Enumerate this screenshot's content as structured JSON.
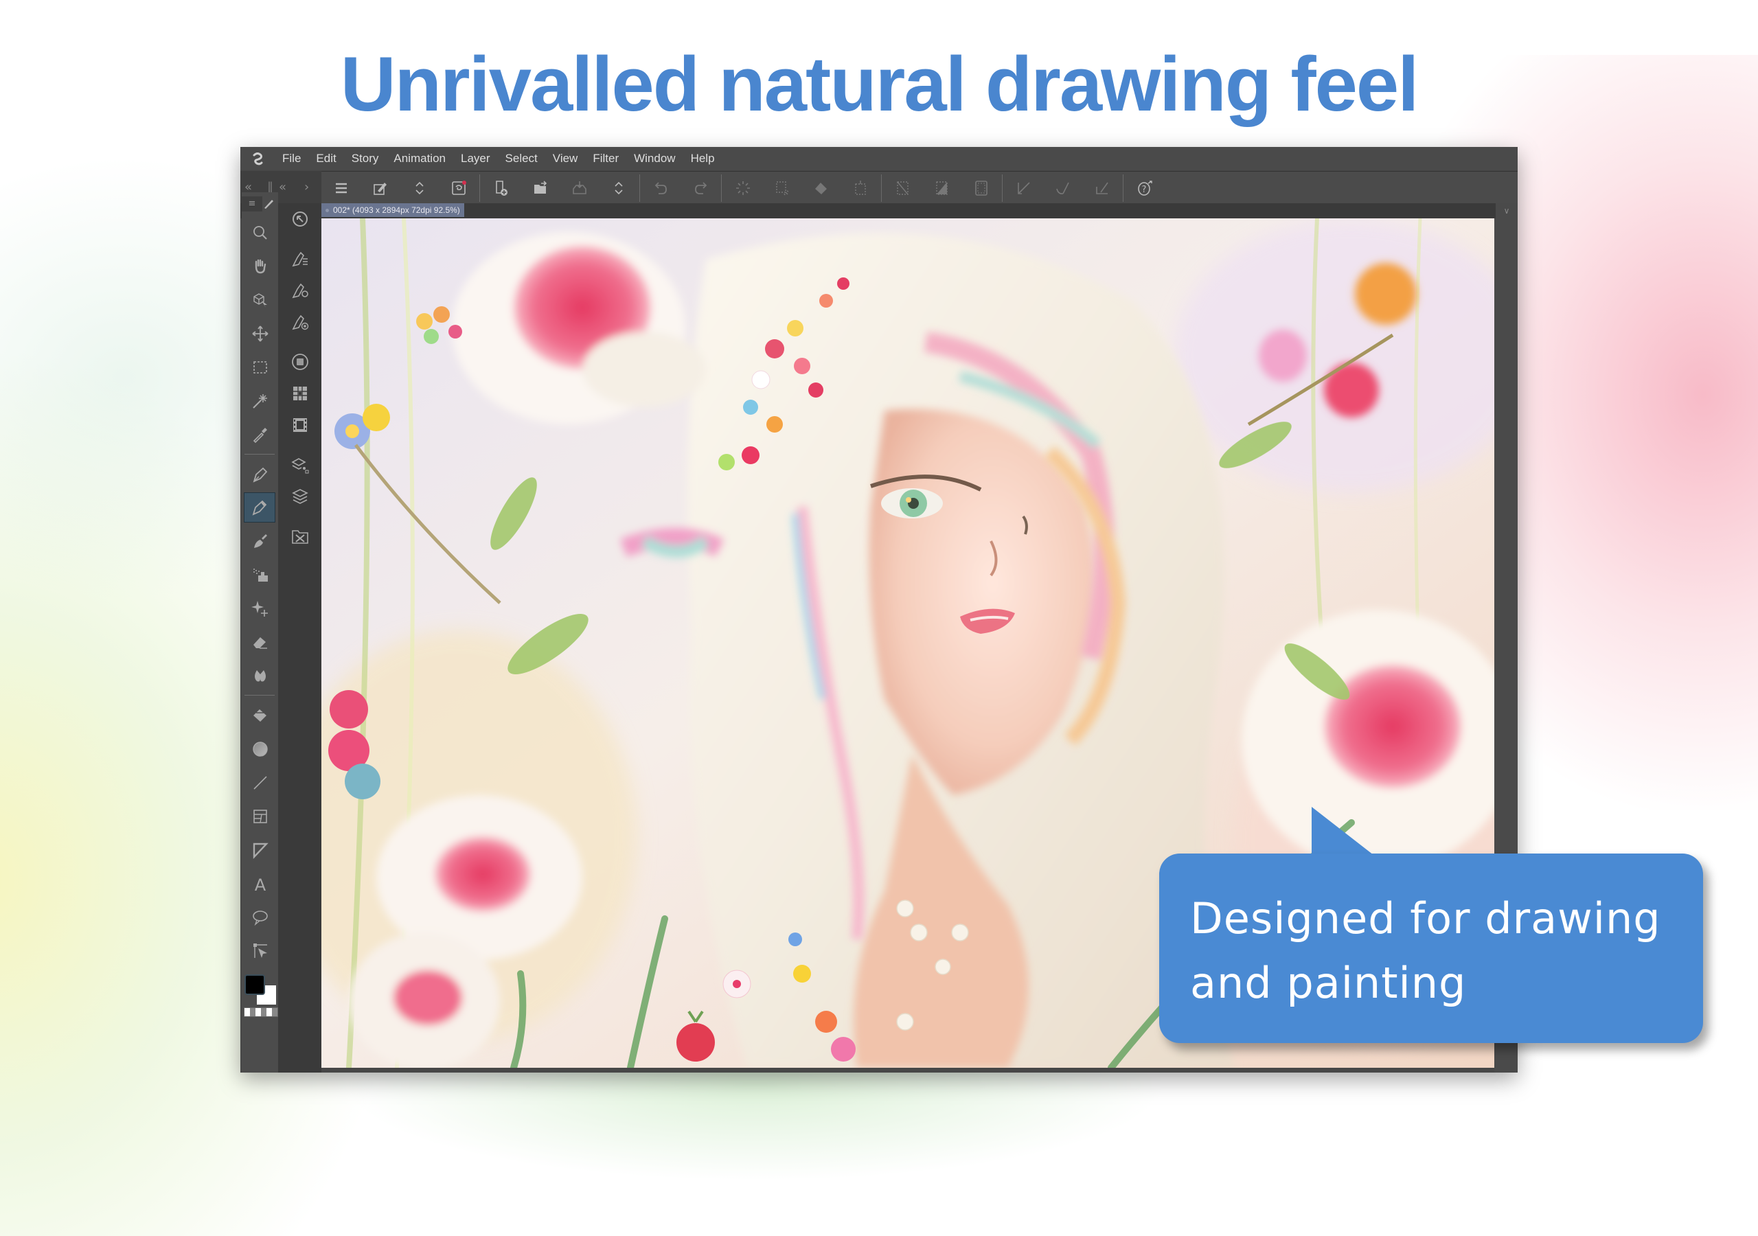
{
  "headline": "Unrivalled natural drawing feel",
  "callout": {
    "line1": "Designed for drawing",
    "line2": "and painting"
  },
  "colors": {
    "accent": "#4a86cf",
    "callout_bg": "#4a8ad3",
    "window_bg": "#474747",
    "doc_tab_bg": "#6a7590",
    "active_tool_bg": "#3c5566",
    "main_color": "#000000",
    "sub_color": "#ffffff"
  },
  "app": {
    "logo_icon": "clip-studio-logo-icon",
    "menu": [
      "File",
      "Edit",
      "Story",
      "Animation",
      "Layer",
      "Select",
      "View",
      "Filter",
      "Window",
      "Help"
    ]
  },
  "panel_controls": {
    "collapse_left": "«",
    "divider": "‖",
    "collapse_left2": "«",
    "expand_right": "›"
  },
  "command_bar": {
    "groups": [
      [
        "menu-icon",
        "edit-brush-icon",
        "chevron-updown-icon",
        "clip-studio-icon"
      ],
      [
        "new-file-icon",
        "open-file-icon",
        "save-icon",
        "chevron-updown-icon"
      ],
      [
        "undo-icon",
        "redo-icon"
      ],
      [
        "deselect-icon",
        "clear-outside-icon",
        "fill-icon",
        "transform-icon"
      ],
      [
        "invert-selection-icon",
        "grayscale-area-icon",
        "border-icon"
      ],
      [
        "ruler-icon",
        "snap-curve-icon",
        "snap-grid-icon"
      ],
      [
        "help-icon"
      ]
    ]
  },
  "document_tab": {
    "label": "002* (4093 x 2894px 72dpi 92.5%)"
  },
  "tools": {
    "group1": [
      "zoom-tool",
      "hand-tool",
      "object-select-tool",
      "move-tool",
      "marquee-select-tool",
      "magic-wand-tool",
      "eyedropper-tool"
    ],
    "group2": [
      "pen-tool",
      "pencil-tool",
      "brush-tool",
      "airbrush-tool",
      "decoration-tool",
      "eraser-tool",
      "blend-tool"
    ],
    "group3": [
      "fill-tool",
      "gradient-tool",
      "figure-tool",
      "frame-border-tool",
      "ruler-tool",
      "text-tool",
      "balloon-tool",
      "correct-line-tool"
    ],
    "active": "pencil-tool"
  },
  "sub_tools": [
    "navigator-icon",
    "sub-tool-detail-icon",
    "tool-property-icon",
    "brush-size-icon",
    "color-wheel-icon",
    "color-set-icon",
    "animation-timeline-icon",
    "layer-property-icon",
    "layer-icon",
    "layer-delete-icon"
  ]
}
